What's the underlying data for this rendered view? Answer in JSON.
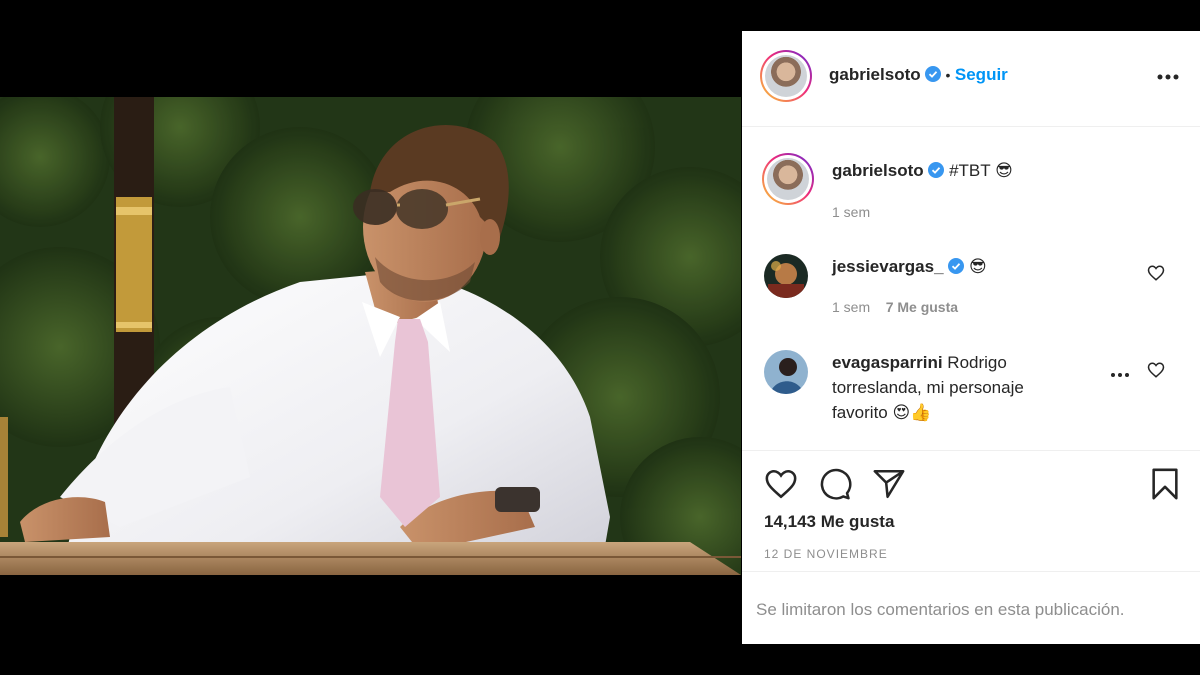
{
  "post": {
    "author": {
      "username": "gabrielsoto",
      "verified": true,
      "follow_separator": "•",
      "follow_label": "Seguir"
    },
    "caption": {
      "username": "gabrielsoto",
      "text": "#TBT 😎",
      "time": "1 sem"
    },
    "comments": [
      {
        "username": "jessievargas_",
        "verified": true,
        "text": "😎",
        "time": "1 sem",
        "likes": "7 Me gusta"
      },
      {
        "username": "evagasparrini",
        "text_lines": [
          "Rodrigo",
          "torreslanda, mi personaje",
          "favorito 😍👍"
        ]
      }
    ],
    "likes": "14,143 Me gusta",
    "date": "12 DE NOVIEMBRE",
    "comments_limited": "Se limitaron los comentarios en esta publicación."
  },
  "icons": {
    "more": "more-horizontal-icon",
    "verified": "verified-badge-icon",
    "like": "heart-icon",
    "comment": "comment-icon",
    "share": "paper-plane-icon",
    "save": "bookmark-icon"
  },
  "colors": {
    "link_blue": "#0095f6",
    "verified_blue": "#3897f0",
    "text": "#262626",
    "muted": "#8e8e8e",
    "background": "#000000"
  }
}
